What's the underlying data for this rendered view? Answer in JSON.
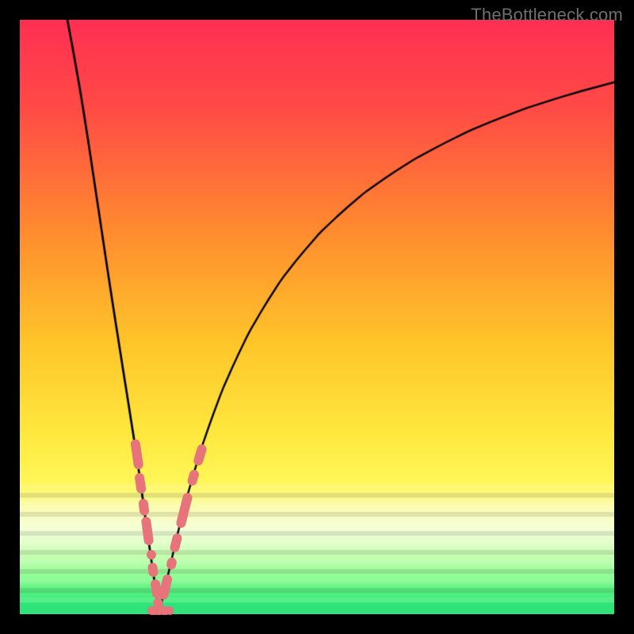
{
  "watermark": {
    "text": "TheBottleneck.com"
  },
  "colors": {
    "frame": "#000000",
    "curve": "#000000",
    "bead": "#e7747a",
    "baseline": "#2fe37a",
    "gradient_stops": [
      {
        "t": 0.0,
        "c": "#ff2f53"
      },
      {
        "t": 0.15,
        "c": "#ff4b46"
      },
      {
        "t": 0.35,
        "c": "#ff8a2f"
      },
      {
        "t": 0.55,
        "c": "#ffc72a"
      },
      {
        "t": 0.7,
        "c": "#ffe93f"
      },
      {
        "t": 0.78,
        "c": "#fff75a"
      },
      {
        "t": 0.82,
        "c": "#fbfcb0"
      },
      {
        "t": 0.86,
        "c": "#f4ffd9"
      },
      {
        "t": 0.9,
        "c": "#c9ffb3"
      },
      {
        "t": 0.94,
        "c": "#8cfc93"
      },
      {
        "t": 0.965,
        "c": "#4ef07e"
      },
      {
        "t": 1.0,
        "c": "#2fe37a"
      }
    ]
  },
  "chart_data": {
    "type": "line",
    "title": "",
    "xlabel": "",
    "ylabel": "",
    "xlim": [
      0,
      100
    ],
    "ylim": [
      0,
      100
    ],
    "notch_x": 23.5,
    "left_branch": [
      {
        "x": 8.0,
        "y": 100.0
      },
      {
        "x": 9.5,
        "y": 92.0
      },
      {
        "x": 11.0,
        "y": 83.0
      },
      {
        "x": 12.5,
        "y": 73.0
      },
      {
        "x": 14.0,
        "y": 63.0
      },
      {
        "x": 15.5,
        "y": 53.0
      },
      {
        "x": 17.0,
        "y": 43.5
      },
      {
        "x": 18.5,
        "y": 34.0
      },
      {
        "x": 20.0,
        "y": 24.5
      },
      {
        "x": 21.0,
        "y": 17.0
      },
      {
        "x": 22.0,
        "y": 10.0
      },
      {
        "x": 22.8,
        "y": 4.5
      },
      {
        "x": 23.5,
        "y": 0.5
      }
    ],
    "right_branch": [
      {
        "x": 23.5,
        "y": 0.5
      },
      {
        "x": 24.2,
        "y": 3.5
      },
      {
        "x": 25.5,
        "y": 9.0
      },
      {
        "x": 27.0,
        "y": 15.5
      },
      {
        "x": 29.0,
        "y": 23.0
      },
      {
        "x": 32.0,
        "y": 32.5
      },
      {
        "x": 36.0,
        "y": 42.5
      },
      {
        "x": 41.0,
        "y": 52.0
      },
      {
        "x": 47.0,
        "y": 60.5
      },
      {
        "x": 54.0,
        "y": 67.8
      },
      {
        "x": 62.0,
        "y": 74.0
      },
      {
        "x": 71.0,
        "y": 79.2
      },
      {
        "x": 80.0,
        "y": 83.3
      },
      {
        "x": 90.0,
        "y": 86.8
      },
      {
        "x": 100.0,
        "y": 89.5
      }
    ],
    "beads_left": [
      {
        "x": 19.7,
        "y": 27.0,
        "len": 5.0
      },
      {
        "x": 20.3,
        "y": 22.0,
        "len": 3.5
      },
      {
        "x": 20.9,
        "y": 18.0,
        "len": 2.8
      },
      {
        "x": 21.5,
        "y": 14.0,
        "len": 4.8
      },
      {
        "x": 22.1,
        "y": 10.0,
        "len": 1.6
      },
      {
        "x": 22.4,
        "y": 7.5,
        "len": 2.4
      },
      {
        "x": 22.9,
        "y": 4.3,
        "len": 3.2
      },
      {
        "x": 23.3,
        "y": 1.7,
        "len": 2.0
      }
    ],
    "beads_right": [
      {
        "x": 24.5,
        "y": 4.5,
        "len": 4.2
      },
      {
        "x": 25.5,
        "y": 8.5,
        "len": 2.0
      },
      {
        "x": 26.3,
        "y": 12.0,
        "len": 3.2
      },
      {
        "x": 27.7,
        "y": 17.5,
        "len": 6.0
      },
      {
        "x": 29.2,
        "y": 23.0,
        "len": 2.6
      },
      {
        "x": 30.3,
        "y": 26.8,
        "len": 3.6
      }
    ],
    "beads_bottom": [
      {
        "x": 22.4,
        "y": 0.6,
        "w": 2.0
      },
      {
        "x": 23.4,
        "y": 0.6,
        "w": 1.8
      },
      {
        "x": 24.4,
        "y": 0.6,
        "w": 1.8
      },
      {
        "x": 25.3,
        "y": 0.6,
        "w": 1.2
      }
    ]
  }
}
